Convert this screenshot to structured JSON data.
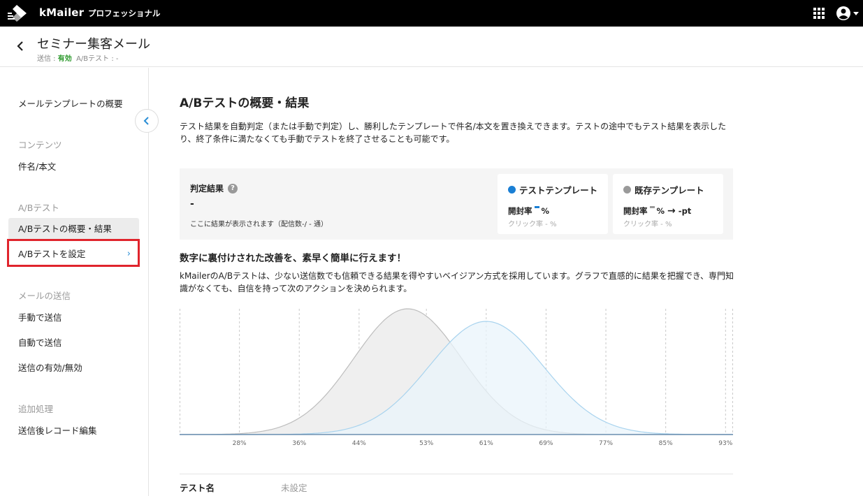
{
  "topbar": {
    "brand": "kMailer",
    "plan": "プロフェッショナル",
    "apps_icon": "grid-apps-icon",
    "account_icon": "account-circle-icon"
  },
  "header": {
    "title": "セミナー集客メール",
    "send_label": "送信 : ",
    "send_status": "有効",
    "ab_label": "A/Bテスト : -"
  },
  "sidebar": {
    "overview": "メールテンプレートの概要",
    "contents_head": "コンテンツ",
    "subject_body": "件名/本文",
    "ab_head": "A/Bテスト",
    "ab_overview": "A/Bテストの概要・結果",
    "ab_settings": "A/Bテストを設定",
    "ab_settings_chevron": "›",
    "send_head": "メールの送信",
    "manual_send": "手動で送信",
    "auto_send": "自動で送信",
    "send_toggle": "送信の有効/無効",
    "post_head": "追加処理",
    "record_edit": "送信後レコード編集"
  },
  "main": {
    "title": "A/Bテストの概要・結果",
    "description": "テスト結果を自動判定（または手動で判定）し、勝利したテンプレートで件名/本文を置き換えできます。テストの途中でもテスト結果を表示したり、終了条件に満たなくても手動でテストを終了させることも可能です。",
    "result": {
      "label": "判定結果",
      "help": "?",
      "value": "-",
      "note": "ここに結果が表示されます（配信数-/ - 通）"
    },
    "test_template": {
      "title": "テストテンプレート",
      "open_label": "開封率",
      "open_unit": "%",
      "click": "クリック率 - %",
      "color": "#1a7fd4"
    },
    "existing_template": {
      "title": "既存テンプレート",
      "open_label": "開封率",
      "open_unit": "%",
      "arrow": "→",
      "diff": "-pt",
      "click": "クリック率 - %",
      "color": "#9a9a9a"
    },
    "subtitle": "数字に裏付けされた改善を、素早く簡単に行えます！",
    "description2": "kMailerのA/Bテストは、少ない送信数でも信頼できる結果を得やすいベイジアン方式を採用しています。グラフで直感的に結果を把握でき、専門知識がなくても、自信を持って次のアクションを決められます。",
    "test_name_label": "テスト名",
    "test_name_value": "未設定"
  },
  "chart_data": {
    "type": "area",
    "x_tick_labels": [
      "28%",
      "36%",
      "44%",
      "53%",
      "61%",
      "69%",
      "77%",
      "85%",
      "93%"
    ],
    "xlim": [
      20,
      94
    ],
    "grid": "vertical dashed",
    "series": [
      {
        "mean": 50.5,
        "sd": 7.2,
        "peak": 1.0,
        "fill": "#efefef",
        "stroke": "#bdbdbd"
      },
      {
        "mean": 61,
        "sd": 7.6,
        "peak": 0.9,
        "fill": "#e9f4fb",
        "stroke": "#a8d3ee"
      }
    ]
  }
}
